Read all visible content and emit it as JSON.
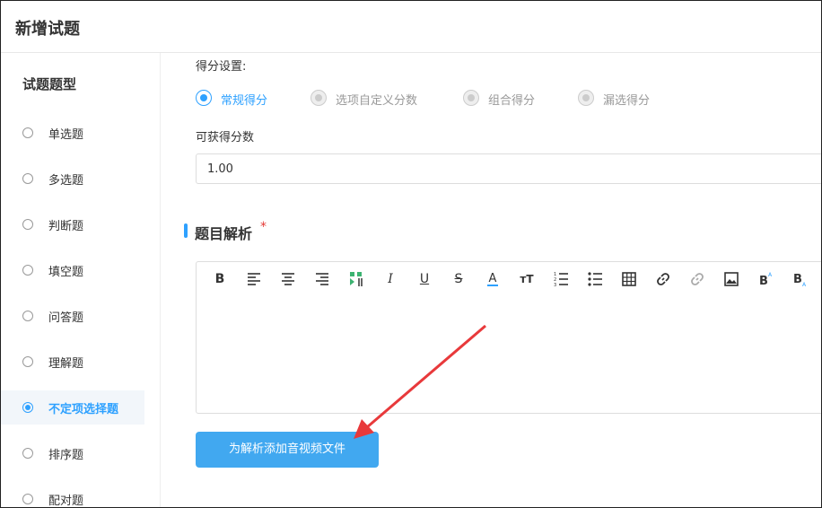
{
  "header": {
    "title": "新增试题"
  },
  "sidebar": {
    "title": "试题题型",
    "items": [
      {
        "label": "单选题"
      },
      {
        "label": "多选题"
      },
      {
        "label": "判断题"
      },
      {
        "label": "填空题"
      },
      {
        "label": "问答题"
      },
      {
        "label": "理解题"
      },
      {
        "label": "不定项选择题"
      },
      {
        "label": "排序题"
      },
      {
        "label": "配对题"
      }
    ],
    "active_index": 6
  },
  "score": {
    "settings_label": "得分设置:",
    "options": [
      {
        "label": "常规得分"
      },
      {
        "label": "选项自定义分数"
      },
      {
        "label": "组合得分"
      },
      {
        "label": "漏选得分"
      }
    ],
    "selected_index": 0,
    "points_label": "可获得分数",
    "points_value": "1.00"
  },
  "analysis": {
    "title": "题目解析",
    "required_mark": "*",
    "toolbar": [
      "bold-icon",
      "align-left-icon",
      "align-center-icon",
      "align-right-icon",
      "paragraph-direction-icon",
      "italic-icon",
      "underline-icon",
      "strikethrough-icon",
      "font-color-icon",
      "font-size-icon",
      "ordered-list-icon",
      "unordered-list-icon",
      "table-icon",
      "link-icon",
      "unlink-icon",
      "image-icon",
      "superscript-icon",
      "subscript-icon"
    ],
    "add_media_button": "为解析添加音视频文件"
  },
  "colors": {
    "accent": "#2ea1ff",
    "button": "#41a8f0",
    "required": "#e53935",
    "arrow": "#e8393b"
  }
}
